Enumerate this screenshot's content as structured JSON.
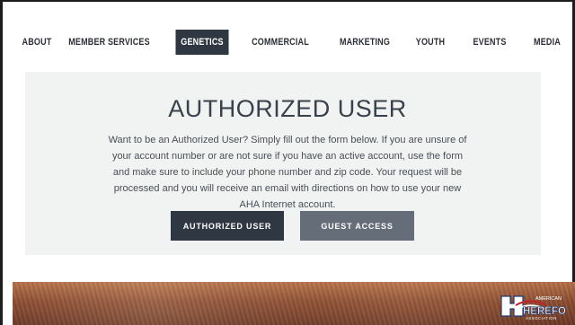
{
  "nav": {
    "items": [
      {
        "label": "ABOUT",
        "active": false
      },
      {
        "label": "MEMBER SERVICES",
        "active": false
      },
      {
        "label": "GENETICS",
        "active": true
      },
      {
        "label": "COMMERCIAL",
        "active": false
      },
      {
        "label": "MARKETING",
        "active": false
      },
      {
        "label": "YOUTH",
        "active": false
      },
      {
        "label": "EVENTS",
        "active": false
      },
      {
        "label": "MEDIA",
        "active": false
      }
    ]
  },
  "main": {
    "title": "AUTHORIZED USER",
    "description": "Want to be an Authorized User? Simply fill out the form below. If you are unsure of your account number or are not sure if you have an active account, use the form and make sure to include your phone number and zip code. Your request will be processed and you will receive an email with directions on how to use your new AHA Internet account.",
    "buttons": {
      "primary": "AUTHORIZED USER",
      "secondary": "GUEST ACCESS"
    }
  },
  "brand": {
    "logo_text": "HEREFORD",
    "logo_small": "AMERICAN",
    "logo_sub": "ASSOCIATION",
    "accent": "#2e3742"
  }
}
